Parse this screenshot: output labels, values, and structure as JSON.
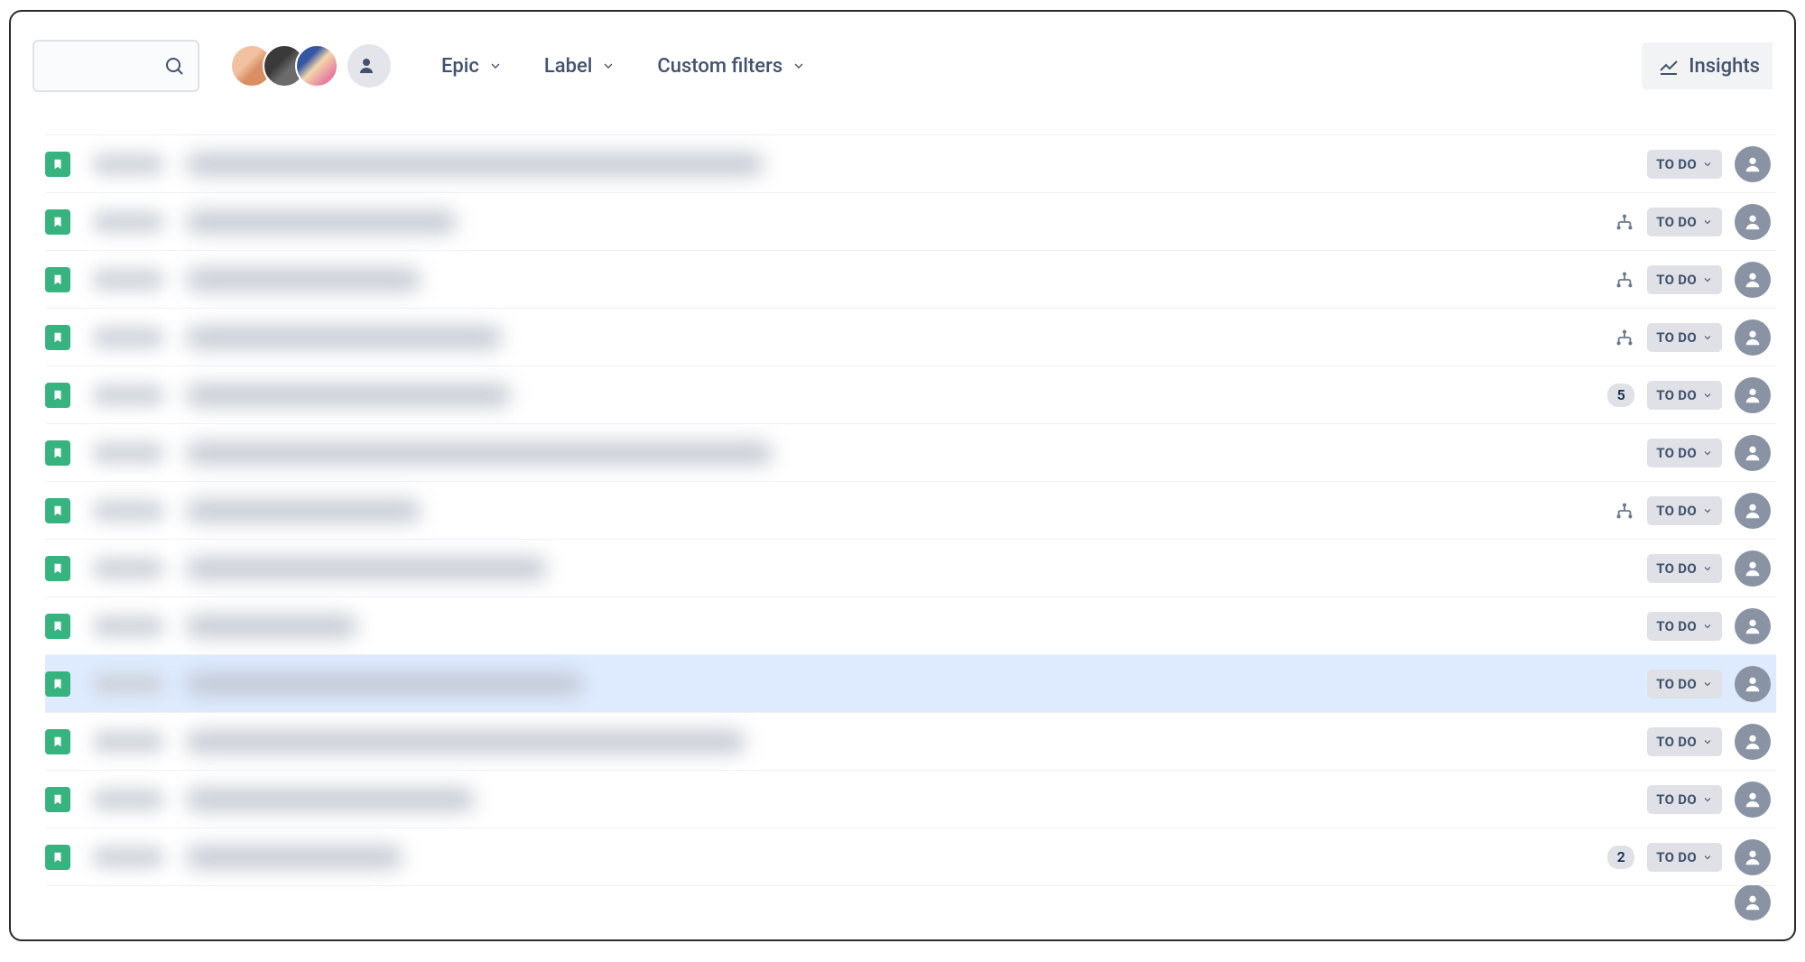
{
  "toolbar": {
    "search_placeholder": "",
    "filters": [
      {
        "label": "Epic"
      },
      {
        "label": "Label"
      },
      {
        "label": "Custom filters"
      }
    ],
    "insights_label": "Insights",
    "avatar_count": 3
  },
  "status_label": "TO DO",
  "rows": [
    {
      "title_width": 640,
      "has_tree": false,
      "count": null,
      "selected": false
    },
    {
      "title_width": 300,
      "has_tree": true,
      "count": null,
      "selected": false
    },
    {
      "title_width": 260,
      "has_tree": true,
      "count": null,
      "selected": false
    },
    {
      "title_width": 350,
      "has_tree": true,
      "count": null,
      "selected": false
    },
    {
      "title_width": 360,
      "has_tree": false,
      "count": 5,
      "selected": false
    },
    {
      "title_width": 650,
      "has_tree": false,
      "count": null,
      "selected": false
    },
    {
      "title_width": 260,
      "has_tree": true,
      "count": null,
      "selected": false
    },
    {
      "title_width": 400,
      "has_tree": false,
      "count": null,
      "selected": false
    },
    {
      "title_width": 190,
      "has_tree": false,
      "count": null,
      "selected": false
    },
    {
      "title_width": 440,
      "has_tree": false,
      "count": null,
      "selected": true
    },
    {
      "title_width": 620,
      "has_tree": false,
      "count": null,
      "selected": false
    },
    {
      "title_width": 320,
      "has_tree": false,
      "count": null,
      "selected": false
    },
    {
      "title_width": 240,
      "has_tree": false,
      "count": 2,
      "selected": false
    }
  ]
}
